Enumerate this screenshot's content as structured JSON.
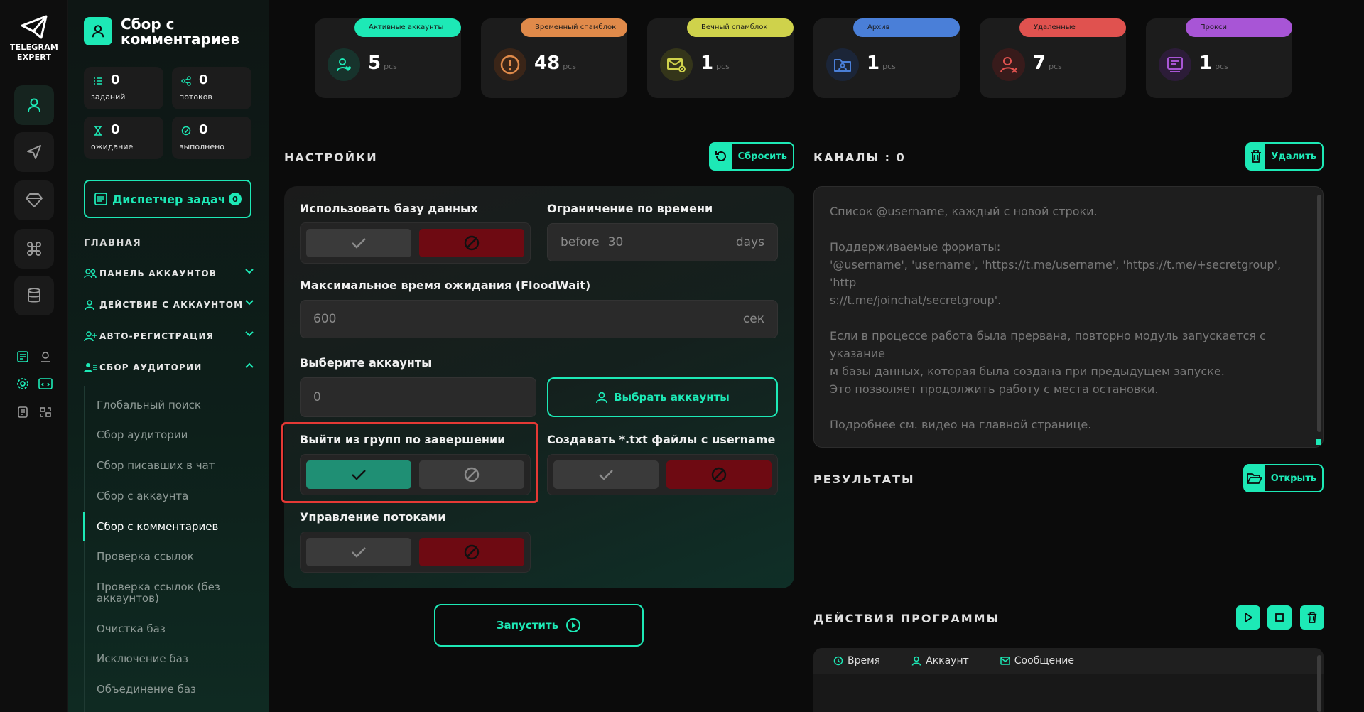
{
  "brand": {
    "line1": "TELEGRAM",
    "line2": "EXPERT"
  },
  "sidebar": {
    "title": "Сбор с комментариев",
    "stats": [
      {
        "value": "0",
        "label": "заданий",
        "icon": "tasks-icon"
      },
      {
        "value": "0",
        "label": "потоков",
        "icon": "threads-icon"
      },
      {
        "value": "0",
        "label": "ожидание",
        "icon": "hourglass-icon"
      },
      {
        "value": "0",
        "label": "выполнено",
        "icon": "check-circle-icon"
      }
    ],
    "dispatcher": {
      "label": "Диспетчер задач",
      "count": "0"
    },
    "section": "ГЛАВНАЯ",
    "groups": [
      {
        "label": "ПАНЕЛЬ АККАУНТОВ",
        "expanded": false
      },
      {
        "label": "ДЕЙСТВИЕ С АККАУНТОМ",
        "expanded": false
      },
      {
        "label": "АВТО-РЕГИСТРАЦИЯ",
        "expanded": false
      },
      {
        "label": "СБОР АУДИТОРИИ",
        "expanded": true
      }
    ],
    "subitems": [
      "Глобальный поиск",
      "Сбор аудитории",
      "Сбор писавших в чат",
      "Сбор с аккаунта",
      "Сбор с комментариев",
      "Проверка ссылок",
      "Проверка ссылок (без аккаунтов)",
      "Очистка баз",
      "Исключение баз",
      "Объединение баз"
    ],
    "active_subitem": "Сбор с комментариев"
  },
  "cards": [
    {
      "tag": "Активные аккаунты",
      "value": "5",
      "unit": "pcs",
      "color": "#1de9b6",
      "icon": "user-heart-icon"
    },
    {
      "tag": "Временный спамблок",
      "value": "48",
      "unit": "pcs",
      "color": "#e08a4a",
      "icon": "warning-circle-icon"
    },
    {
      "tag": "Вечный спамблок",
      "value": "1",
      "unit": "pcs",
      "color": "#cfd24b",
      "icon": "mail-block-icon"
    },
    {
      "tag": "Архив",
      "value": "1",
      "unit": "pcs",
      "color": "#4a7fd8",
      "icon": "archive-folder-icon"
    },
    {
      "tag": "Удаленные",
      "value": "7",
      "unit": "pcs",
      "color": "#e0524f",
      "icon": "user-x-icon"
    },
    {
      "tag": "Прокси",
      "value": "1",
      "unit": "pcs",
      "color": "#a855d6",
      "icon": "proxy-icon"
    }
  ],
  "settings": {
    "title": "НАСТРОЙКИ",
    "reset_label": "Сбросить",
    "use_db": {
      "label": "Использовать базу данных",
      "value": false
    },
    "time_limit": {
      "label": "Ограничение по времени",
      "prefix": "before",
      "value": "30",
      "suffix": "days"
    },
    "floodwait": {
      "label": "Максимальное время ожидания (FloodWait)",
      "value": "600",
      "suffix": "сек"
    },
    "accounts": {
      "label": "Выберите аккаунты",
      "value": "0",
      "button": "Выбрать аккаунты"
    },
    "leave_groups": {
      "label": "Выйти из групп по завершении",
      "value": true
    },
    "create_txt": {
      "label": "Создавать *.txt файлы с username",
      "value": false
    },
    "threads_control": {
      "label": "Управление потоками",
      "value": false
    },
    "start_label": "Запустить"
  },
  "channels": {
    "title": "КАНАЛЫ : 0",
    "delete_label": "Удалить",
    "placeholder_lines": [
      "Список @username, каждый с новой строки.",
      "",
      "Поддерживаемые форматы:",
      "'@username', 'username', 'https://t.me/username', 'https://t.me/+secretgroup', 'http",
      "s://t.me/joinchat/secretgroup'.",
      "",
      "Если в процессе работа была прервана, повторно модуль запускается с указание",
      "м базы данных, которая была создана при предыдущем запуске.",
      "Это позволяет продолжить работу с места остановки.",
      "",
      "Подробнее см. видео на главной странице."
    ]
  },
  "results": {
    "title": "РЕЗУЛЬТАТЫ",
    "open_label": "Открыть"
  },
  "actions": {
    "title": "ДЕЙСТВИЯ ПРОГРАММЫ",
    "columns": [
      "Время",
      "Аккаунт",
      "Сообщение"
    ]
  },
  "colors": {
    "accent": "#1de9b6",
    "danger": "#6e0a12",
    "highlight": "#e53935"
  }
}
